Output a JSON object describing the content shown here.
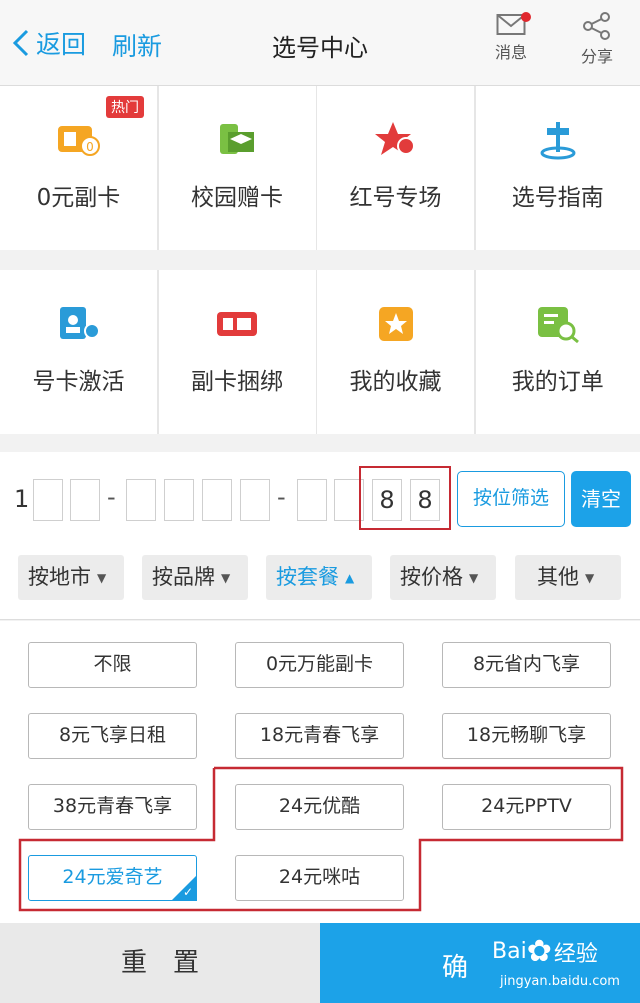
{
  "header": {
    "back_label": "返回",
    "refresh_label": "刷新",
    "title": "选号中心",
    "message_label": "消息",
    "share_label": "分享"
  },
  "menu_row1": [
    {
      "label": "0元副卡",
      "icon": "sim-coin-icon",
      "badge": "热门"
    },
    {
      "label": "校园赠卡",
      "icon": "campus-sim-icon"
    },
    {
      "label": "红号专场",
      "icon": "red-star-icon"
    },
    {
      "label": "选号指南",
      "icon": "guide-icon"
    }
  ],
  "menu_row2": [
    {
      "label": "号卡激活",
      "icon": "activate-card-icon"
    },
    {
      "label": "副卡捆绑",
      "icon": "bind-card-icon"
    },
    {
      "label": "我的收藏",
      "icon": "favorite-star-icon"
    },
    {
      "label": "我的订单",
      "icon": "order-search-icon"
    }
  ],
  "number": {
    "prefix": "1",
    "last_digits": [
      "8",
      "8"
    ],
    "filter_button": "按位筛选",
    "clear_button": "清空"
  },
  "filters": [
    "按地市",
    "按品牌",
    "按套餐",
    "按价格",
    "其他"
  ],
  "active_filter": "按套餐",
  "packages": [
    "不限",
    "0元万能副卡",
    "8元省内飞享",
    "8元飞享日租",
    "18元青春飞享",
    "18元畅聊飞享",
    "38元青春飞享",
    "24元优酷",
    "24元PPTV",
    "24元爱奇艺",
    "24元咪咕"
  ],
  "selected_package": "24元爱奇艺",
  "footer": {
    "reset": "重　置",
    "confirm": "确"
  },
  "watermark": {
    "brand": "Bai",
    "brand2": "经验",
    "url": "jingyan.baidu.com"
  },
  "colors": {
    "accent": "#1a9be0",
    "highlight_red": "#c62a33"
  }
}
